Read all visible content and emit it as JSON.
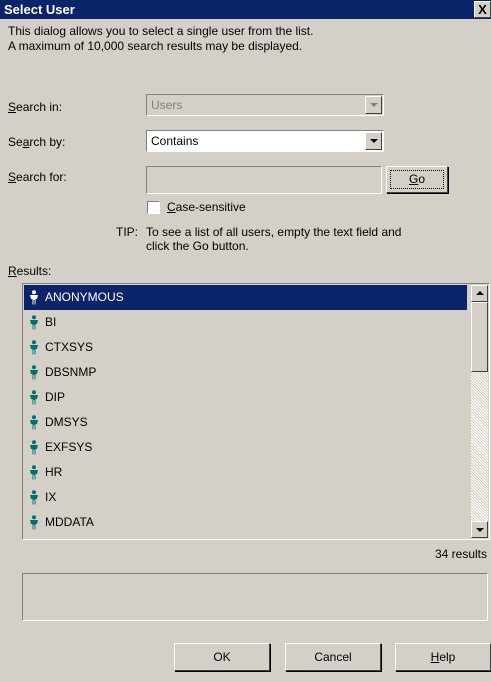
{
  "window": {
    "title": "Select User",
    "close_label": "X"
  },
  "description": {
    "line1": "This dialog allows you to select a single user from the list.",
    "line2": "A maximum of 10,000 search results may be displayed."
  },
  "search_in": {
    "label_u": "S",
    "label_rest": "earch in:",
    "value": "Users",
    "disabled": true
  },
  "search_by": {
    "label_pre": "Se",
    "label_u": "a",
    "label_rest": "rch by:",
    "value": "Contains"
  },
  "search_for": {
    "label_u": "S",
    "label_rest": "earch for:",
    "value": ""
  },
  "go_button": {
    "label_u": "G",
    "label_rest": "o"
  },
  "case_sensitive": {
    "label_u": "C",
    "label_rest": "ase-sensitive",
    "checked": false
  },
  "tip": {
    "label": "TIP:",
    "line1": "To see a list of all users, empty the text field and",
    "line2": "click the Go button."
  },
  "results": {
    "label_u": "R",
    "label_rest": "esults:",
    "selected_index": 0,
    "items": [
      {
        "name": "ANONYMOUS"
      },
      {
        "name": "BI"
      },
      {
        "name": "CTXSYS"
      },
      {
        "name": "DBSNMP"
      },
      {
        "name": "DIP"
      },
      {
        "name": "DMSYS"
      },
      {
        "name": "EXFSYS"
      },
      {
        "name": "HR"
      },
      {
        "name": "IX"
      },
      {
        "name": "MDDATA"
      }
    ],
    "count_text": "34 results"
  },
  "buttons": {
    "ok": "OK",
    "cancel": "Cancel",
    "help_u": "H",
    "help_rest": "elp"
  },
  "colors": {
    "titlebar": "#0a246a",
    "selection": "#0a246a",
    "face": "#d4d0c8",
    "icon": "#007070"
  },
  "icons": {
    "user": "user-icon",
    "close": "close-icon"
  }
}
